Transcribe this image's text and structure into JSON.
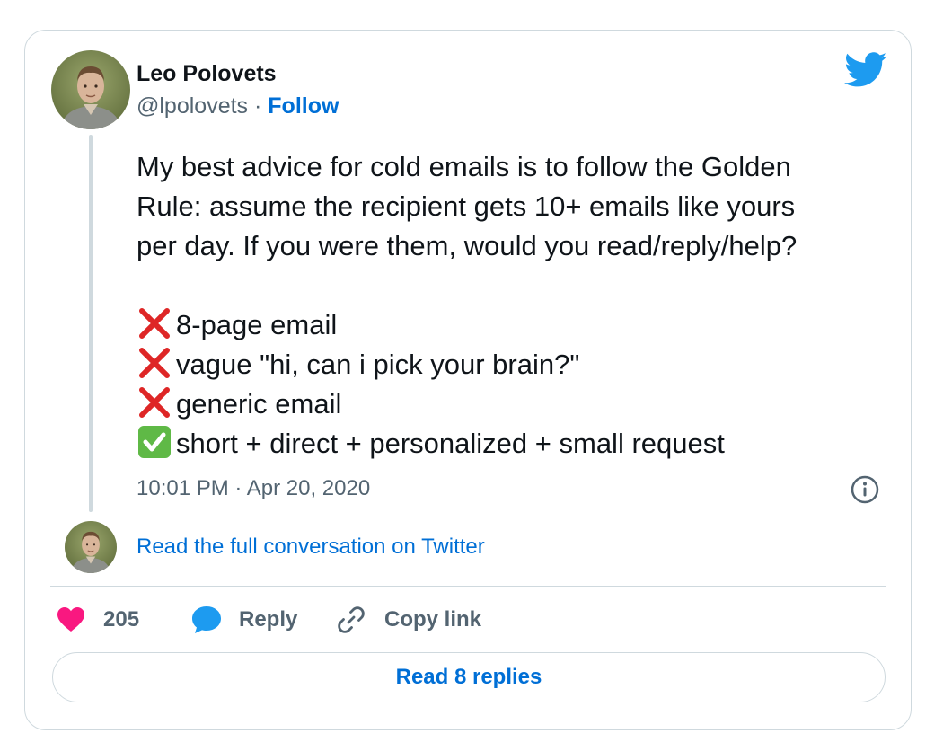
{
  "tweet": {
    "author": {
      "name": "Leo Polovets",
      "handle": "@lpolovets",
      "separator": " · ",
      "follow_label": "Follow"
    },
    "text_lines": [
      "My best advice for cold emails is to follow the Golden",
      "Rule: assume the recipient gets 10+ emails like yours",
      "per day. If you were them, would you read/reply/help?"
    ],
    "list_items": [
      {
        "mark": "cross-mark-icon",
        "text": "8-page email"
      },
      {
        "mark": "cross-mark-icon",
        "text": "vague \"hi, can i pick your brain?\""
      },
      {
        "mark": "cross-mark-icon",
        "text": "generic email"
      },
      {
        "mark": "check-mark-icon",
        "text": "short + direct + personalized + small request"
      }
    ],
    "timestamp": "10:01 PM · Apr 20, 2020",
    "read_full_label": "Read the full conversation on Twitter"
  },
  "actions": {
    "like_count": "205",
    "reply_label": "Reply",
    "copy_label": "Copy link",
    "read_replies_label": "Read 8 replies"
  },
  "colors": {
    "link": "#006fd6",
    "secondary_text": "#536471",
    "heart": "#f91880",
    "reply_bubble": "#1d9bf0",
    "twitter_blue": "#1d9bf0",
    "cross": "#de2626",
    "check_bg": "#5fb946",
    "border": "#cfd9de"
  }
}
